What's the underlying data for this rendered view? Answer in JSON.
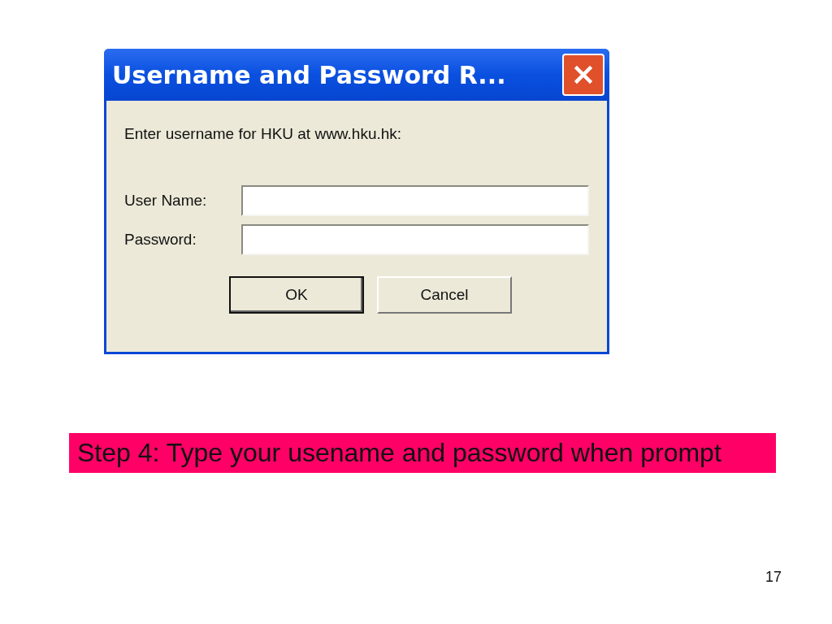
{
  "dialog": {
    "title": "Username and Password R...",
    "prompt": "Enter username for HKU at www.hku.hk:",
    "fields": [
      {
        "label": "User Name:"
      },
      {
        "label": "Password:"
      }
    ],
    "buttons": [
      {
        "label": "OK",
        "default": true
      },
      {
        "label": "Cancel",
        "default": false
      }
    ]
  },
  "caption": "Step 4: Type your usename and password when prompt",
  "page_number": "17"
}
